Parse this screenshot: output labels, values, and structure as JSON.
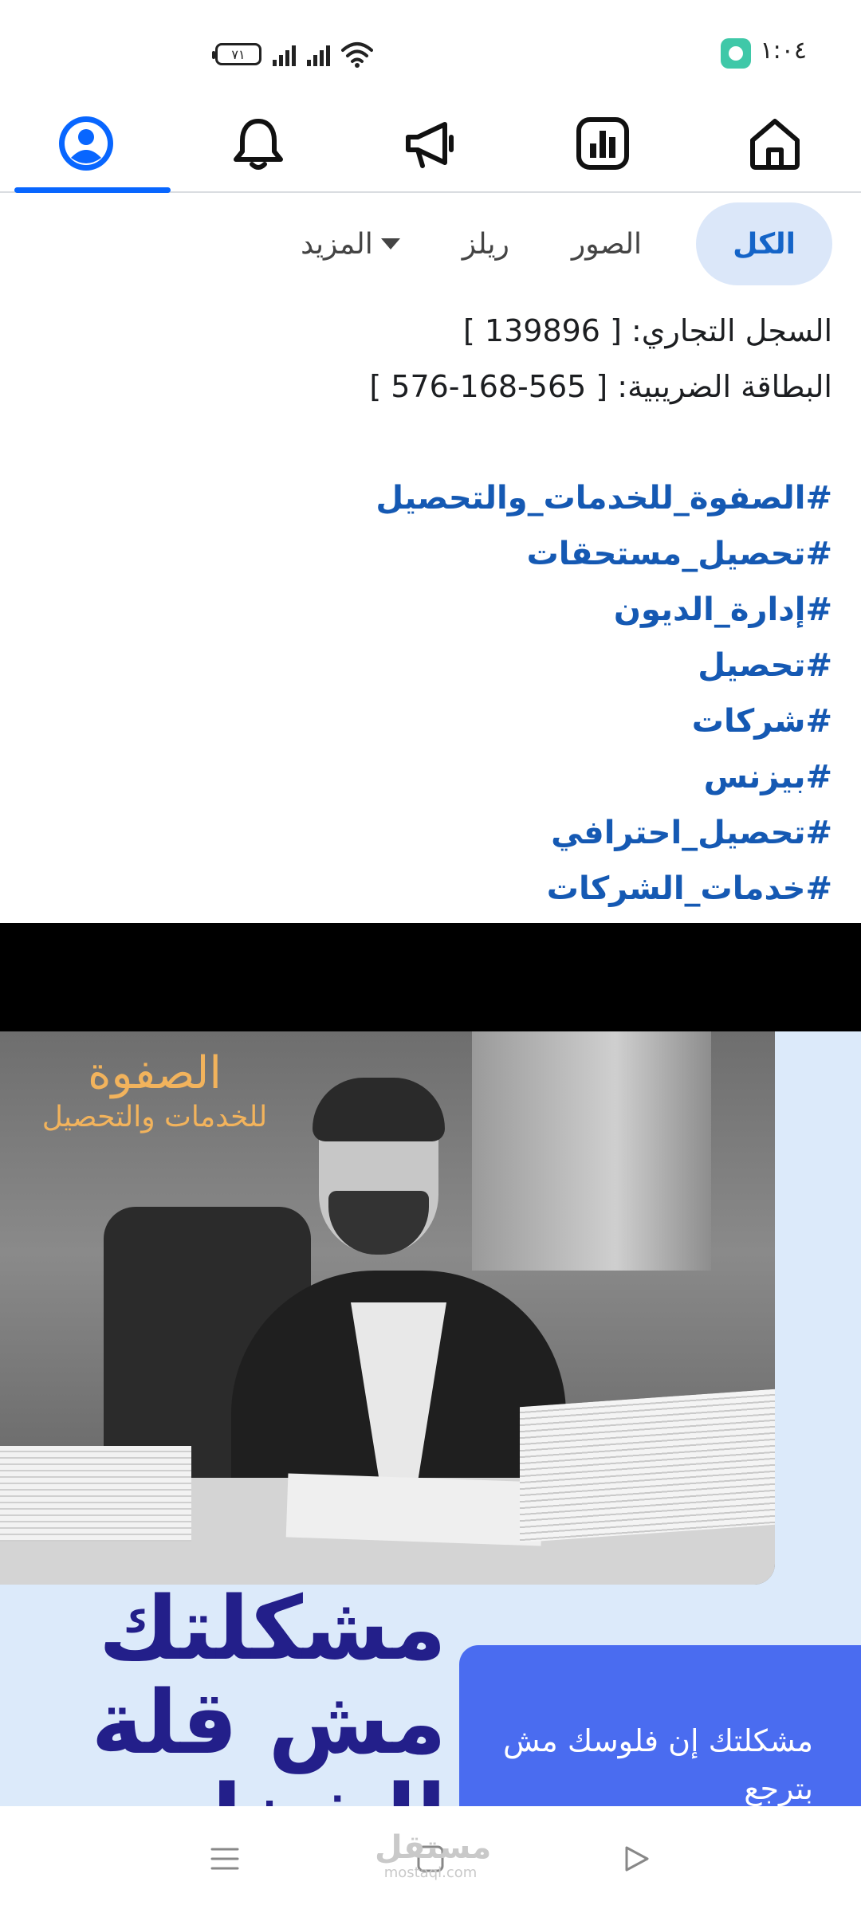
{
  "status_bar": {
    "time": "١:٠٤",
    "battery": "٧١"
  },
  "top_nav": {
    "items": [
      {
        "name": "home",
        "icon": "home-icon"
      },
      {
        "name": "dashboard",
        "icon": "chart-icon"
      },
      {
        "name": "ads",
        "icon": "megaphone-icon"
      },
      {
        "name": "notifications",
        "icon": "bell-icon"
      },
      {
        "name": "profile",
        "icon": "profile-icon",
        "active": true
      }
    ],
    "accent": "#0866ff"
  },
  "filters": {
    "all": "الكل",
    "photos": "الصور",
    "reels": "ريلز",
    "more": "المزيد"
  },
  "bio": {
    "commercial_register": "السجل التجاري: [ 139896 ]",
    "tax_card": "البطاقة الضريبية: [ 565-168-576 ]",
    "hashtags": [
      "#الصفوة_للخدمات_والتحصيل",
      "#تحصيل_مستحقات",
      "#إدارة_الديون",
      "#تحصيل",
      "#شركات",
      "#بيزنس",
      "#تحصيل_احترافي",
      "#خدمات_الشركات"
    ],
    "hashtag_color": "#1559b3"
  },
  "post": {
    "brand_line1": "الصفوة",
    "brand_line2": "للخدمات والتحصيل",
    "headline": "مشكلتك مش قلة الشغل...",
    "promo": "مشكلتك إن فلوسك مش بترجع"
  },
  "watermark": {
    "text": "مستقل",
    "sub": "mostaql.com"
  }
}
